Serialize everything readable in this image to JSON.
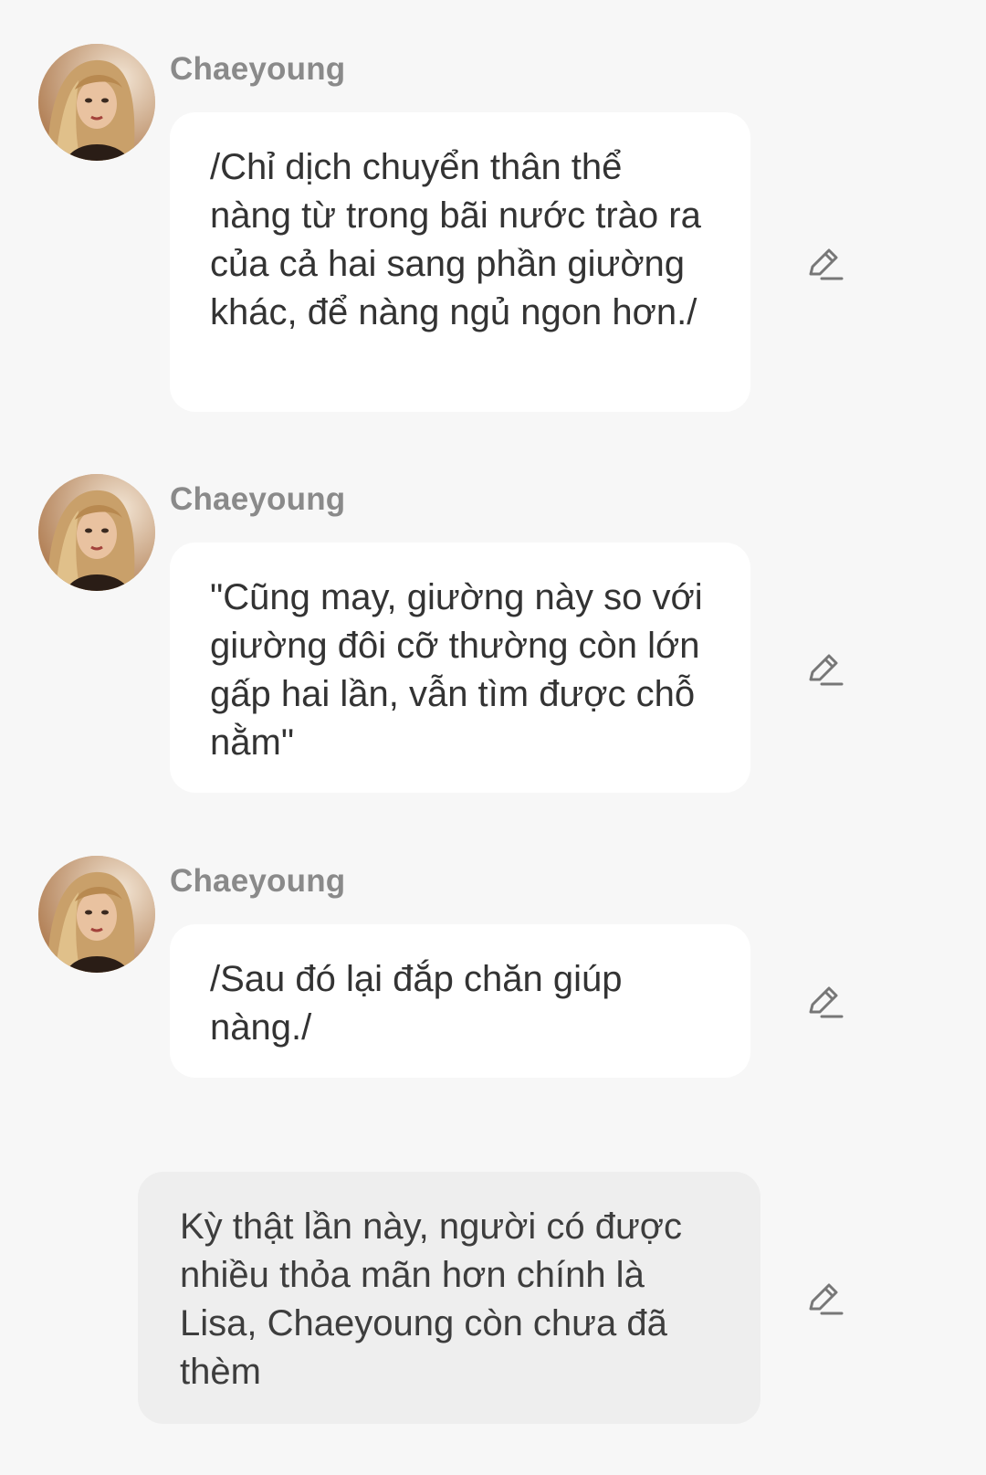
{
  "messages": [
    {
      "role": "character",
      "sender": "Chaeyoung",
      "avatar_icon": "profile-photo-avatar",
      "text": "/Chỉ dịch chuyển thân thể nàng từ trong bãi nước trào ra của cả hai sang phần giường khác, để nàng ngủ ngon hơn./",
      "edit_icon": "pencil-edit-icon"
    },
    {
      "role": "character",
      "sender": "Chaeyoung",
      "avatar_icon": "profile-photo-avatar",
      "text": "\"Cũng may, giường này so với giường đôi cỡ thường còn lớn gấp hai lần, vẫn tìm được chỗ nằm\"",
      "edit_icon": "pencil-edit-icon"
    },
    {
      "role": "character",
      "sender": "Chaeyoung",
      "avatar_icon": "profile-photo-avatar",
      "text": "/Sau đó lại đắp chăn giúp nàng./",
      "edit_icon": "pencil-edit-icon"
    },
    {
      "role": "user",
      "text": "Kỳ thật lần này, người có được nhiều thỏa mãn hơn chính là Lisa, Chaeyoung còn chưa đã thèm",
      "edit_icon": "pencil-edit-icon"
    }
  ],
  "colors": {
    "background": "#f7f7f7",
    "bot_bubble": "#ffffff",
    "user_bubble": "#eeeeee",
    "sender_name": "#8a8a8a",
    "text": "#333333",
    "icon": "#777777"
  }
}
